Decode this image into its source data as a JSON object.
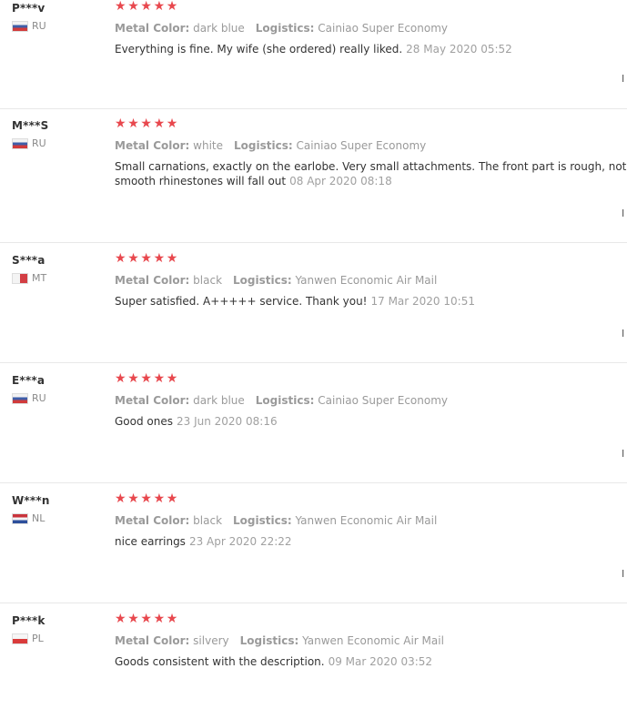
{
  "reviews": [
    {
      "user": "P***v",
      "country": "RU",
      "flag": "ru",
      "stars": 5,
      "attrs": [
        {
          "label": "Metal Color:",
          "value": "dark blue"
        },
        {
          "label": "Logistics:",
          "value": "Cainiao Super Economy"
        }
      ],
      "text": "Everything is fine. My wife (she ordered) really liked.",
      "date": "28 May 2020 05:52",
      "edge": "I"
    },
    {
      "user": "M***S",
      "country": "RU",
      "flag": "ru",
      "stars": 5,
      "attrs": [
        {
          "label": "Metal Color:",
          "value": "white"
        },
        {
          "label": "Logistics:",
          "value": "Cainiao Super Economy"
        }
      ],
      "text": "Small carnations, exactly on the earlobe. Very small attachments. The front part is rough, not smooth rhinestones will fall out",
      "date": "08 Apr 2020 08:18",
      "edge": "I"
    },
    {
      "user": "S***a",
      "country": "MT",
      "flag": "mt",
      "stars": 5,
      "attrs": [
        {
          "label": "Metal Color:",
          "value": "black"
        },
        {
          "label": "Logistics:",
          "value": "Yanwen Economic Air Mail"
        }
      ],
      "text": "Super satisfied. A+++++ service. Thank you!",
      "date": "17 Mar 2020 10:51",
      "edge": "I"
    },
    {
      "user": "E***a",
      "country": "RU",
      "flag": "ru",
      "stars": 5,
      "attrs": [
        {
          "label": "Metal Color:",
          "value": "dark blue"
        },
        {
          "label": "Logistics:",
          "value": "Cainiao Super Economy"
        }
      ],
      "text": "Good ones",
      "date": "23 Jun 2020 08:16",
      "edge": "I"
    },
    {
      "user": "W***n",
      "country": "NL",
      "flag": "nl",
      "stars": 5,
      "attrs": [
        {
          "label": "Metal Color:",
          "value": "black"
        },
        {
          "label": "Logistics:",
          "value": "Yanwen Economic Air Mail"
        }
      ],
      "text": "nice earrings",
      "date": "23 Apr 2020 22:22",
      "edge": "I"
    },
    {
      "user": "P***k",
      "country": "PL",
      "flag": "pl",
      "stars": 5,
      "attrs": [
        {
          "label": "Metal Color:",
          "value": "silvery"
        },
        {
          "label": "Logistics:",
          "value": "Yanwen Economic Air Mail"
        }
      ],
      "text": "Goods consistent with the description.",
      "date": "09 Mar 2020 03:52",
      "edge": ""
    }
  ],
  "colors": {
    "star": "#e8484e",
    "muted": "#9a9a9a",
    "divider": "#e8e8e8"
  },
  "icons": {
    "star": "star-icon"
  }
}
